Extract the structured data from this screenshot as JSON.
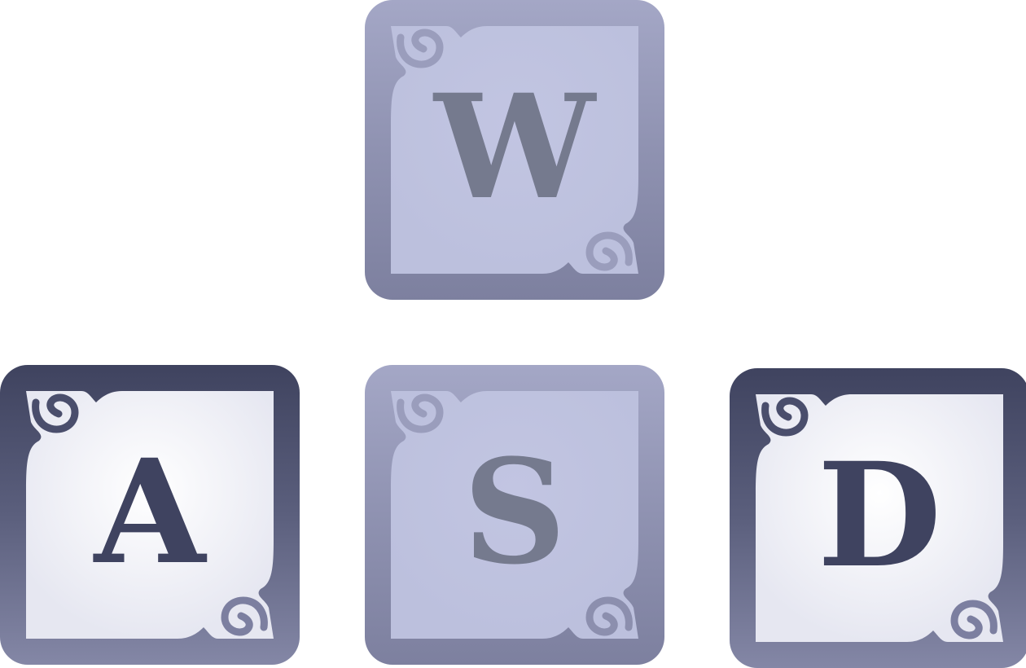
{
  "keys": {
    "w": {
      "label": "W",
      "state": "dim"
    },
    "a": {
      "label": "A",
      "state": "active"
    },
    "s": {
      "label": "S",
      "state": "dim"
    },
    "d": {
      "label": "D",
      "state": "active"
    }
  },
  "colors": {
    "dim_face": "#bdc1de",
    "dim_border": "#9a9dbc",
    "dim_glyph": "#757a8e",
    "active_face": "#f2f3f8",
    "active_border": "#4a4e6c",
    "active_glyph": "#3f4360"
  },
  "icons": [
    "corner-swirl-icon"
  ]
}
